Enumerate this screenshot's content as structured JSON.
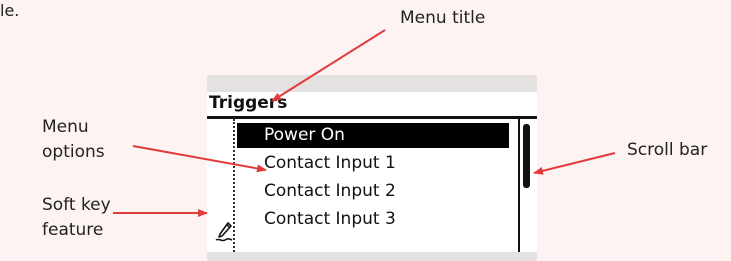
{
  "page_fragment": "le.",
  "callouts": {
    "menu_title": "Menu title",
    "menu_options": [
      "Menu",
      "options"
    ],
    "soft_key_feature": [
      "Soft key",
      "feature"
    ],
    "scroll_bar": "Scroll bar"
  },
  "screen": {
    "title": "Triggers",
    "options": [
      {
        "label": "Power On",
        "selected": true
      },
      {
        "label": "Contact Input 1",
        "selected": false
      },
      {
        "label": "Contact Input 2",
        "selected": false
      },
      {
        "label": "Contact Input 3",
        "selected": false
      }
    ],
    "softkey_icon": "pencil-icon"
  },
  "colors": {
    "arrow": "#e23b3b",
    "background": "#fdf3f3",
    "selection": "#000000"
  }
}
